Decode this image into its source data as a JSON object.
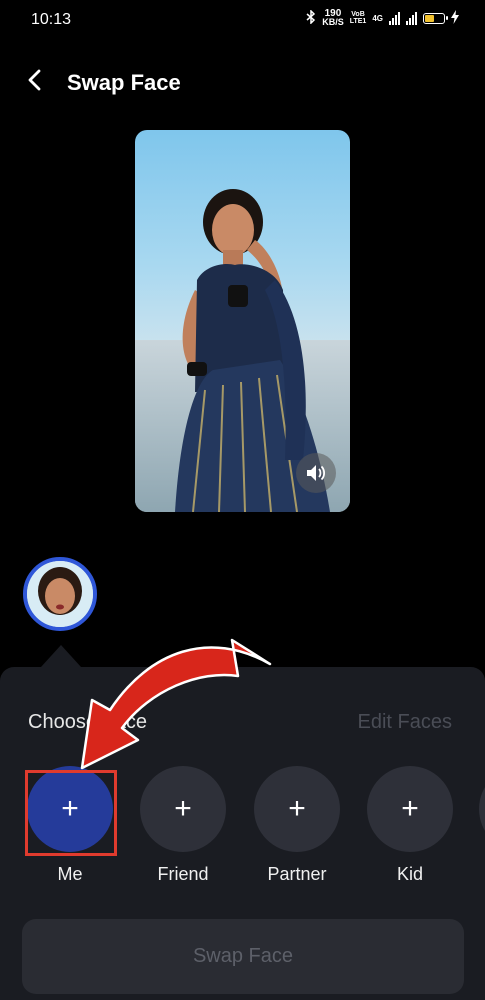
{
  "status": {
    "time": "10:13",
    "speed_value": "190",
    "speed_unit": "KB/S",
    "volte_top": "VoB",
    "volte_bottom": "LTE1",
    "net": "4G"
  },
  "header": {
    "title": "Swap Face"
  },
  "sheet": {
    "choose_label": "Choose Face",
    "edit_label": "Edit Faces",
    "faces": [
      {
        "label": "Me",
        "icon": "plus-icon",
        "selected": true
      },
      {
        "label": "Friend",
        "icon": "plus-icon",
        "selected": false
      },
      {
        "label": "Partner",
        "icon": "plus-icon",
        "selected": false
      },
      {
        "label": "Kid",
        "icon": "plus-icon",
        "selected": false
      }
    ],
    "plus_glyph": "+",
    "swap_button": "Swap Face"
  },
  "colors": {
    "accent": "#2f57d8",
    "highlight": "#e03b2e",
    "sheet": "#1a1c22"
  }
}
